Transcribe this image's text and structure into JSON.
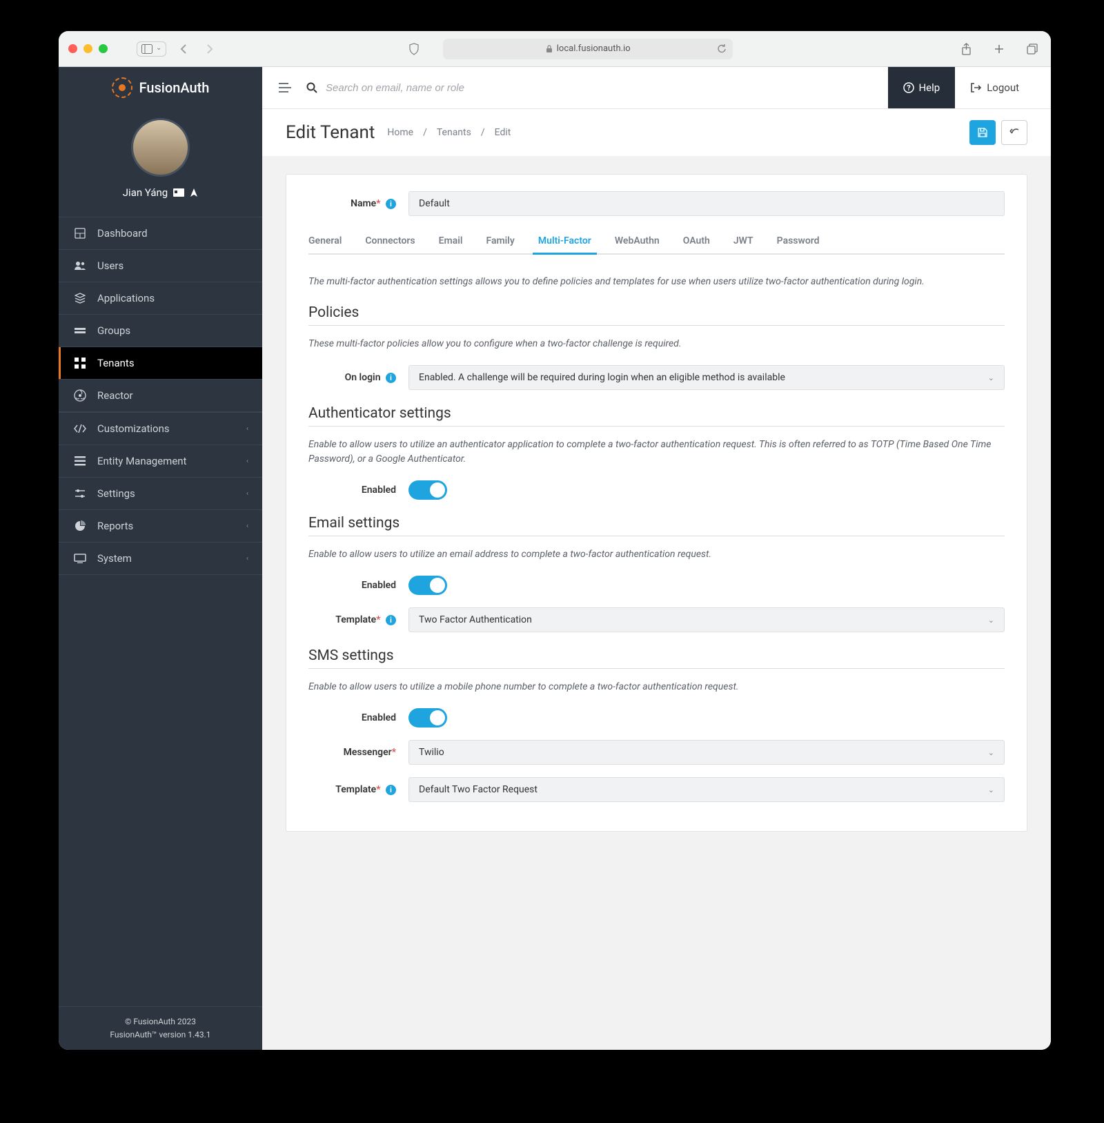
{
  "browser": {
    "url": "local.fusionauth.io"
  },
  "logo": {
    "text": "FusionAuth"
  },
  "user": {
    "name": "Jian Yáng"
  },
  "sidebar": {
    "items": [
      {
        "icon": "dashboard",
        "label": "Dashboard"
      },
      {
        "icon": "users",
        "label": "Users"
      },
      {
        "icon": "apps",
        "label": "Applications"
      },
      {
        "icon": "groups",
        "label": "Groups"
      },
      {
        "icon": "tenants",
        "label": "Tenants",
        "active": true
      },
      {
        "icon": "reactor",
        "label": "Reactor"
      },
      {
        "icon": "custom",
        "label": "Customizations",
        "caret": true
      },
      {
        "icon": "entity",
        "label": "Entity Management",
        "caret": true
      },
      {
        "icon": "settings",
        "label": "Settings",
        "caret": true
      },
      {
        "icon": "reports",
        "label": "Reports",
        "caret": true
      },
      {
        "icon": "system",
        "label": "System",
        "caret": true
      }
    ]
  },
  "footer": {
    "line1": "© FusionAuth 2023",
    "line2": "FusionAuth™ version 1.43.1"
  },
  "topbar": {
    "search_placeholder": "Search on email, name or role",
    "help": "Help",
    "logout": "Logout"
  },
  "header": {
    "title": "Edit Tenant",
    "breadcrumb": [
      "Home",
      "Tenants",
      "Edit"
    ]
  },
  "form": {
    "name_label": "Name",
    "name_value": "Default"
  },
  "tabs": [
    "General",
    "Connectors",
    "Email",
    "Family",
    "Multi-Factor",
    "WebAuthn",
    "OAuth",
    "JWT",
    "Password"
  ],
  "active_tab": "Multi-Factor",
  "mfa": {
    "intro": "The multi-factor authentication settings allows you to define policies and templates for use when users utilize two-factor authentication during login.",
    "policies_h": "Policies",
    "policies_desc": "These multi-factor policies allow you to configure when a two-factor challenge is required.",
    "on_login_label": "On login",
    "on_login_value": "Enabled. A challenge will be required during login when an eligible method is available",
    "auth_h": "Authenticator settings",
    "auth_desc": "Enable to allow users to utilize an authenticator application to complete a two-factor authentication request. This is often referred to as TOTP (Time Based One Time Password), or a Google Authenticator.",
    "enabled_label": "Enabled",
    "email_h": "Email settings",
    "email_desc": "Enable to allow users to utilize an email address to complete a two-factor authentication request.",
    "template_label": "Template",
    "email_template": "Two Factor Authentication",
    "sms_h": "SMS settings",
    "sms_desc": "Enable to allow users to utilize a mobile phone number to complete a two-factor authentication request.",
    "messenger_label": "Messenger",
    "sms_messenger": "Twilio",
    "sms_template": "Default Two Factor Request"
  }
}
